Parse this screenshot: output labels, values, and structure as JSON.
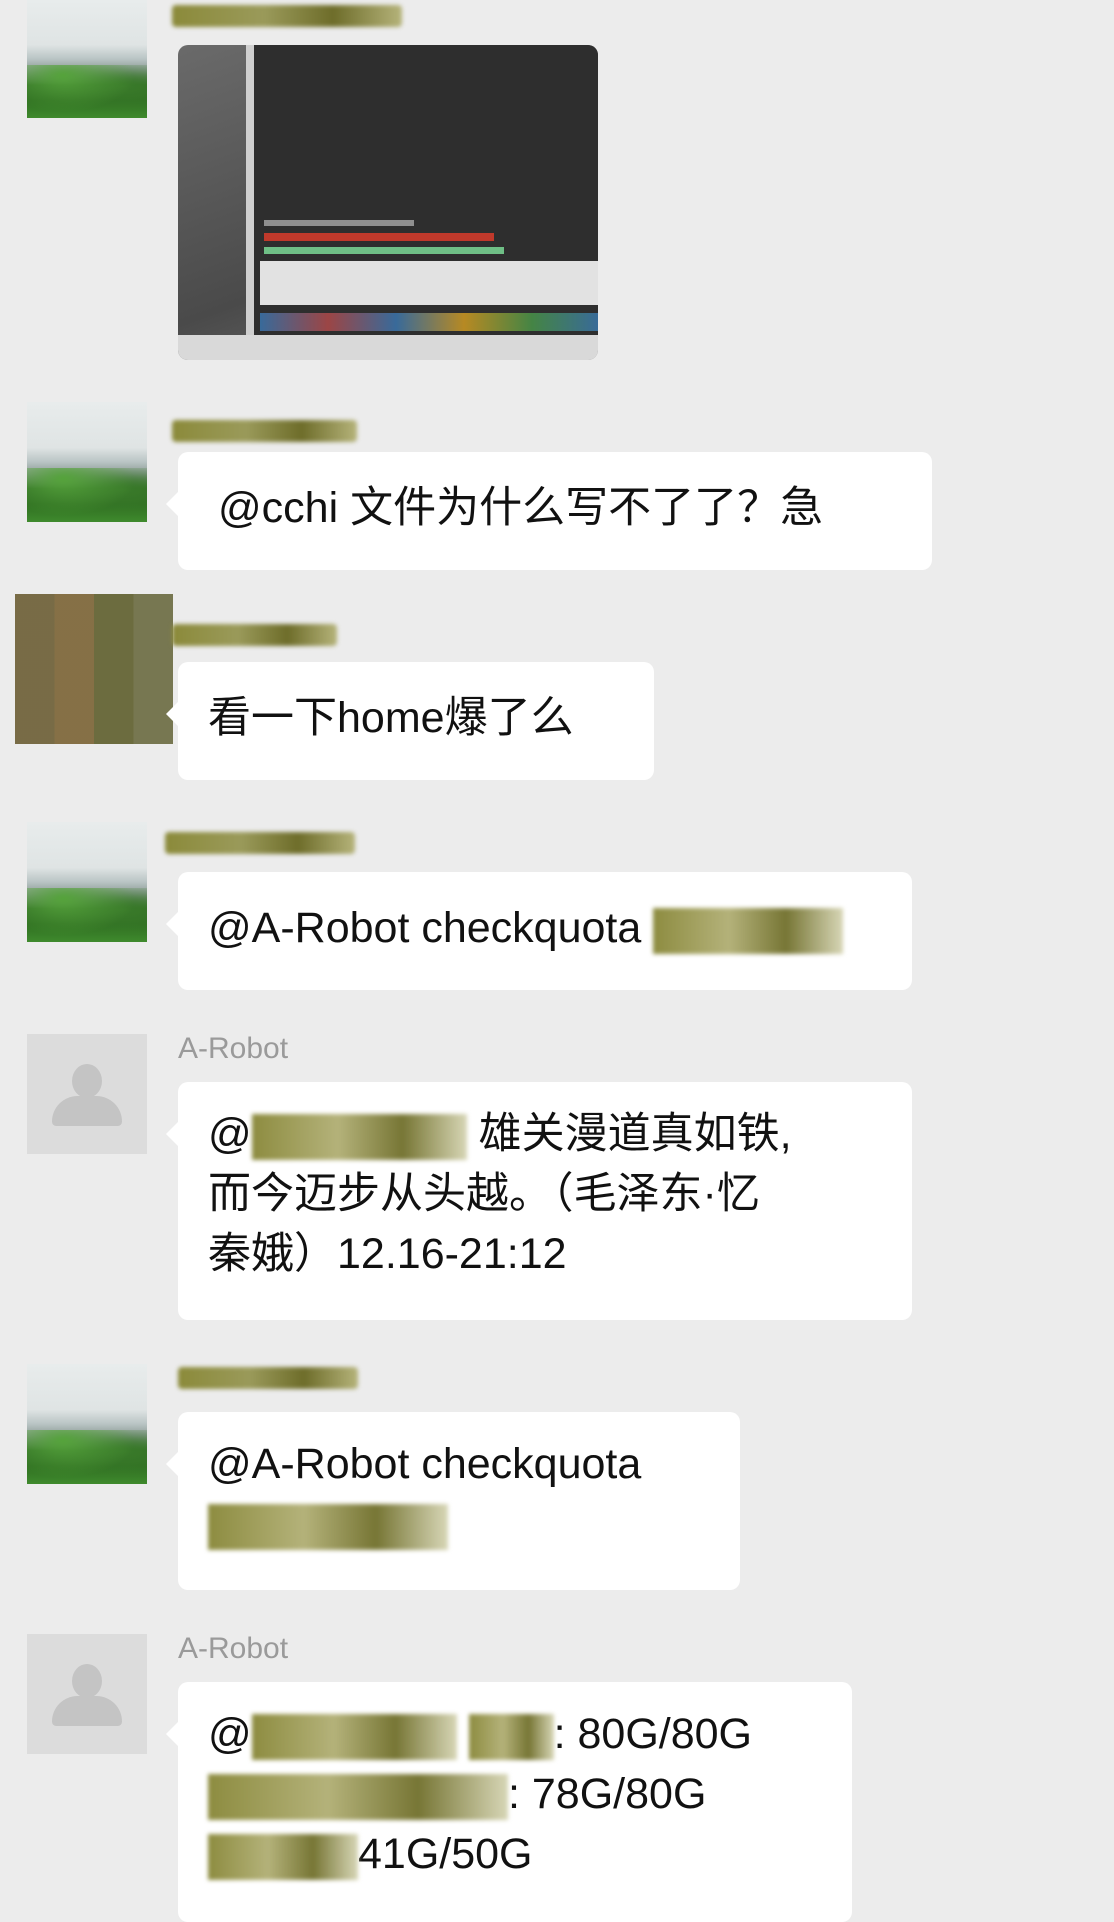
{
  "messages": [
    {
      "type": "image",
      "sender_blurred": true
    },
    {
      "type": "text",
      "sender_blurred": true,
      "text": "@cchi 文件为什么写不了了？急"
    },
    {
      "type": "text",
      "sender_blurred": true,
      "text": "看一下home爆了么"
    },
    {
      "type": "text",
      "sender_blurred": true,
      "text_prefix": "@A-Robot checkquota "
    },
    {
      "type": "text",
      "sender": "A-Robot",
      "line1_suffix": " 雄关漫道真如铁,",
      "line2": "而今迈步从头越。（毛泽东·忆",
      "line3": "秦娥）12.16-21:12"
    },
    {
      "type": "text",
      "sender_blurred": true,
      "text_prefix": "@A-Robot checkquota"
    },
    {
      "type": "text",
      "sender": "A-Robot",
      "line1_suffix": ": 80G/80G",
      "line2_suffix": ": 78G/80G",
      "line3_suffix": "41G/50G"
    }
  ]
}
